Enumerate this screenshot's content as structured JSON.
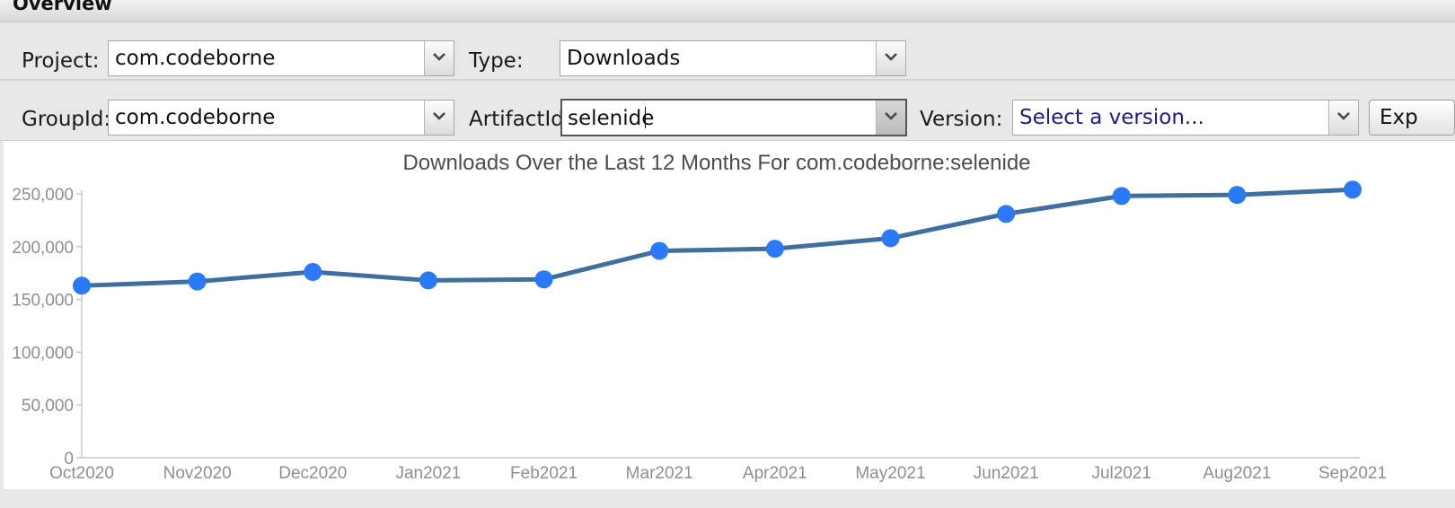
{
  "header": {
    "title": "Overview"
  },
  "filters": {
    "project_label": "Project:",
    "project_value": "com.codeborne",
    "type_label": "Type:",
    "type_value": "Downloads",
    "groupid_label": "GroupId:",
    "groupid_value": "com.codeborne",
    "artifactid_label": "ArtifactId:",
    "artifactid_value": "selenide",
    "version_label": "Version:",
    "version_placeholder": "Select a version...",
    "export_label": "Exp"
  },
  "colors": {
    "line": "#3f6f9f",
    "point": "#2a7af7",
    "axis_text": "#8f8f8f",
    "title_text": "#4d4d4d"
  },
  "chart_data": {
    "type": "line",
    "title": "Downloads Over the Last 12 Months For com.codeborne:selenide",
    "xlabel": "",
    "ylabel": "",
    "categories": [
      "Oct2020",
      "Nov2020",
      "Dec2020",
      "Jan2021",
      "Feb2021",
      "Mar2021",
      "Apr2021",
      "May2021",
      "Jun2021",
      "Jul2021",
      "Aug2021",
      "Sep2021"
    ],
    "series": [
      {
        "values": [
          163000,
          167000,
          176000,
          168000,
          169000,
          196000,
          198000,
          208000,
          231000,
          248000,
          249000,
          254000
        ]
      }
    ],
    "ylim": [
      0,
      250000
    ],
    "yticks": [
      0,
      50000,
      100000,
      150000,
      200000,
      250000
    ],
    "ytick_labels": [
      "0",
      "50,000",
      "100,000",
      "150,000",
      "200,000",
      "250,000"
    ],
    "grid": false,
    "legend": "none"
  }
}
